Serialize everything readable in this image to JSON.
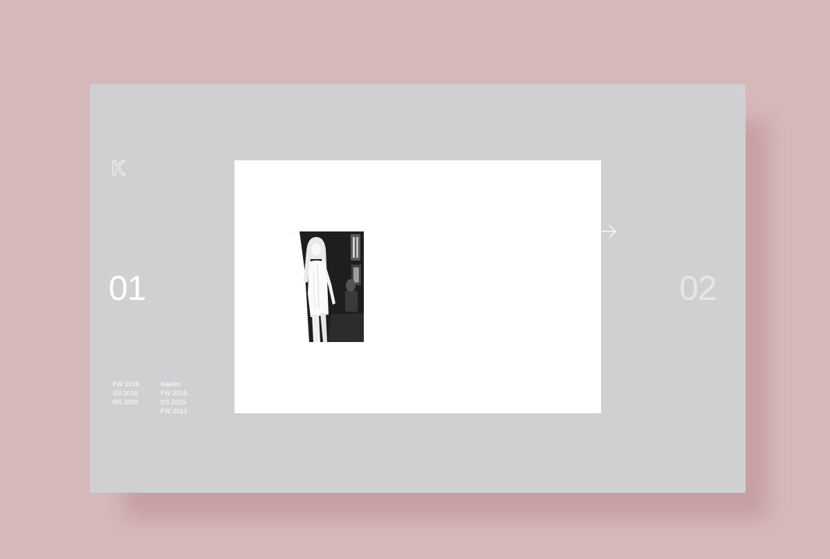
{
  "brand": {
    "logo_letter": "K"
  },
  "slider": {
    "current_index": "01",
    "next_index": "02"
  },
  "nav": {
    "col1": [
      {
        "label": "FW 2016"
      },
      {
        "label": "SS 2016"
      },
      {
        "label": "RS 2016"
      }
    ],
    "col2": [
      {
        "label": "Kaelen"
      },
      {
        "label": "FW 2015"
      },
      {
        "label": "SS 2015"
      },
      {
        "label": "FW 2014"
      }
    ]
  },
  "icons": {
    "logo": "k-logo-icon",
    "next": "arrow-right-icon"
  },
  "colors": {
    "page_background": "#d5b8ba",
    "card_background": "#d0d0d2",
    "stage_background": "#ffffff",
    "text": "#ffffff"
  }
}
